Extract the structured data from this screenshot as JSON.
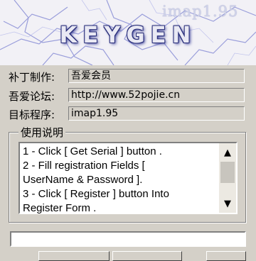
{
  "banner": {
    "title": "KEYGEN",
    "version": "imap1.95"
  },
  "info": {
    "patch_label": "补丁制作:",
    "patch_value": "吾爱会员",
    "forum_label": "吾爱论坛:",
    "forum_value": "http://www.52pojie.cn",
    "target_label": "目标程序:",
    "target_value": "imap1.95"
  },
  "usage": {
    "title": "使用说明",
    "lines": [
      "1 - Click [ Get Serial ] button .",
      "2 - Fill registration Fields [",
      "UserName & Password ].",
      "3 - Click [ Register ] button Into",
      "Register Form ."
    ]
  },
  "serial": {
    "value": ""
  },
  "icons": {
    "scroll_up": "▲",
    "scroll_down": "▼"
  }
}
